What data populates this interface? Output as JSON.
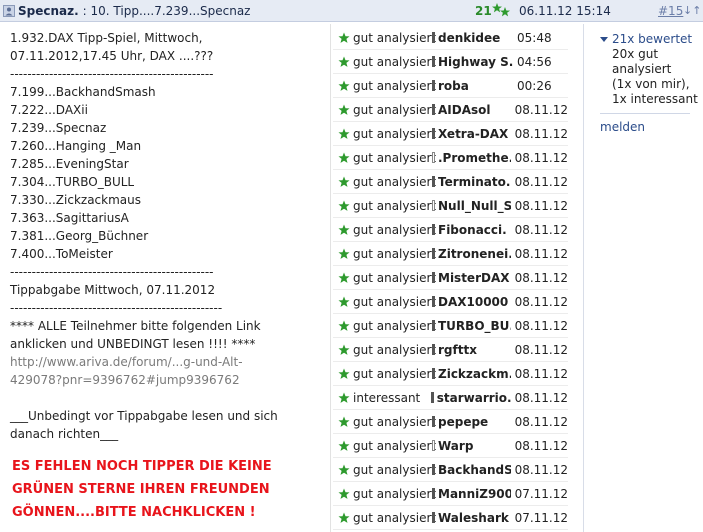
{
  "header": {
    "author": "Specnaz.",
    "title": ": 10. Tipp....7.239...Specnaz",
    "count": "21",
    "date": "06.11.12 15:14",
    "post_link": "#15",
    "arrows": "↓↑"
  },
  "post": {
    "lines": [
      "1.932.DAX Tipp-Spiel, Mittwoch,",
      "07.11.2012,17.45 Uhr, DAX ....???",
      "-----------------------------------------------",
      "7.199...BackhandSmash",
      "7.222...DAXii",
      "7.239...Specnaz",
      "7.260...Hanging _Man",
      "7.285...EveningStar",
      "7.304...TURBO_BULL",
      "7.330...Zickzackmaus",
      "7.363...SagittariusA",
      "7.381...Georg_Büchner",
      "7.400...ToMeister",
      "-----------------------------------------------",
      "Tippabgabe Mittwoch, 07.11.2012",
      "-------------------------------------------------"
    ],
    "notice_1": "****  ALLE Teilnehmer bitte folgenden Link anklicken und UNBEDINGT lesen !!!! ****",
    "link": "http://www.ariva.de/forum/...g-und-Alt-429078?pnr=9396762#jump9396762",
    "notice_2": "___Unbedingt vor Tippabgabe lesen und sich danach richten___",
    "red_note": "ES FEHLEN NOCH TIPPER DIE KEINE GRÜNEN STERNE IHREN FREUNDEN GÖNNEN....BITTE NACHKLICKEN !"
  },
  "ratings": [
    {
      "label": "gut analysiert",
      "name": "denkidee",
      "date": "05:48",
      "bar": "dark"
    },
    {
      "label": "gut analysiert",
      "name": "Highway S.",
      "date": "04:56",
      "bar": "dark"
    },
    {
      "label": "gut analysiert",
      "name": "roba",
      "date": "00:26",
      "bar": "dark"
    },
    {
      "label": "gut analysiert",
      "name": "AIDAsol",
      "date": "08.11.12",
      "bar": "dark"
    },
    {
      "label": "gut analysiert",
      "name": "Xetra-DAX",
      "date": "08.11.12",
      "bar": "dark"
    },
    {
      "label": "gut analysiert",
      "name": ".Promethe.",
      "date": "08.11.12",
      "bar": "light"
    },
    {
      "label": "gut analysiert",
      "name": "Terminato.",
      "date": "08.11.12",
      "bar": "dark"
    },
    {
      "label": "gut analysiert",
      "name": "Null_Null_S.",
      "date": "08.11.12",
      "bar": "light"
    },
    {
      "label": "gut analysiert",
      "name": "Fibonacci.",
      "date": "08.11.12",
      "bar": "dark"
    },
    {
      "label": "gut analysiert",
      "name": "Zitronenei.",
      "date": "08.11.12",
      "bar": "dark"
    },
    {
      "label": "gut analysiert",
      "name": "MisterDAX",
      "date": "08.11.12",
      "bar": "dark"
    },
    {
      "label": "gut analysiert",
      "name": "DAX10000",
      "date": "08.11.12",
      "bar": "dark"
    },
    {
      "label": "gut analysiert",
      "name": "TURBO_BU.",
      "date": "08.11.12",
      "bar": "dark"
    },
    {
      "label": "gut analysiert",
      "name": "rgfttx",
      "date": "08.11.12",
      "bar": "dark"
    },
    {
      "label": "gut analysiert",
      "name": "Zickzackm.",
      "date": "08.11.12",
      "bar": "dark"
    },
    {
      "label": "interessant",
      "name": "starwarrio.",
      "date": "08.11.12",
      "bar": "dark"
    },
    {
      "label": "gut analysiert",
      "name": "pepepe",
      "date": "08.11.12",
      "bar": "dark"
    },
    {
      "label": "gut analysiert",
      "name": "Warp",
      "date": "08.11.12",
      "bar": "light"
    },
    {
      "label": "gut analysiert",
      "name": "BackhandS.",
      "date": "08.11.12",
      "bar": "dark"
    },
    {
      "label": "gut analysiert",
      "name": "ManniZ900",
      "date": "07.11.12",
      "bar": "dark"
    },
    {
      "label": "gut analysiert",
      "name": "Waleshark",
      "date": "07.11.12",
      "bar": "dark"
    }
  ],
  "sidebar": {
    "rated": "21x bewertet",
    "detail_1": "20x gut analysiert",
    "detail_2": "(1x von mir),",
    "detail_3": "1x interessant",
    "report": "melden"
  },
  "colors": {
    "accent": "#2b4c8a",
    "star": "#2e9a2e",
    "red_note": "#e8141b",
    "header_bg": "#e6ebf4"
  }
}
